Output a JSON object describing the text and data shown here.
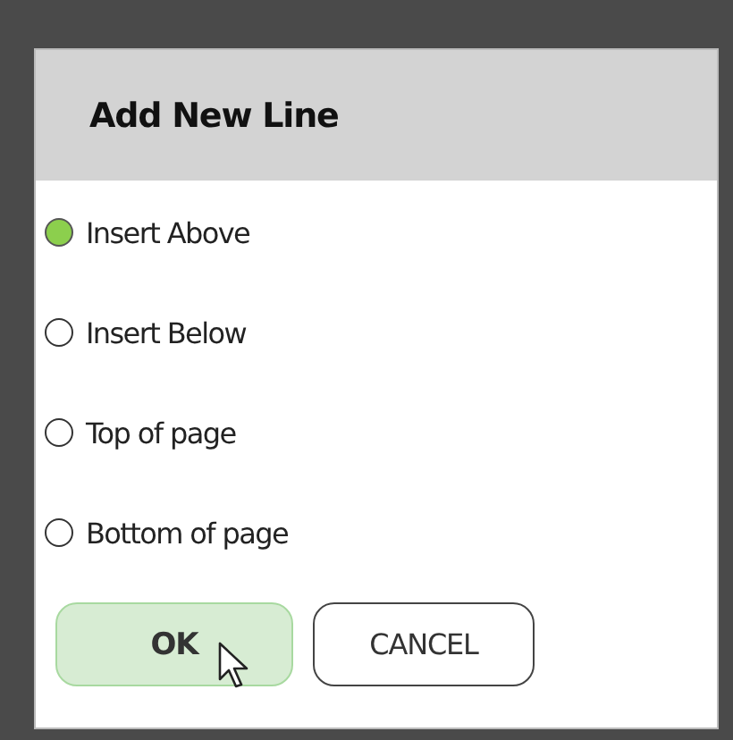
{
  "dialog": {
    "title": "Add New Line"
  },
  "options": [
    {
      "label": "Insert Above",
      "selected": true
    },
    {
      "label": "Insert Below",
      "selected": false
    },
    {
      "label": "Top of page",
      "selected": false
    },
    {
      "label": "Bottom of page",
      "selected": false
    }
  ],
  "buttons": [
    {
      "label": "OK",
      "primary": true
    },
    {
      "label": "CANCEL",
      "primary": false
    }
  ]
}
